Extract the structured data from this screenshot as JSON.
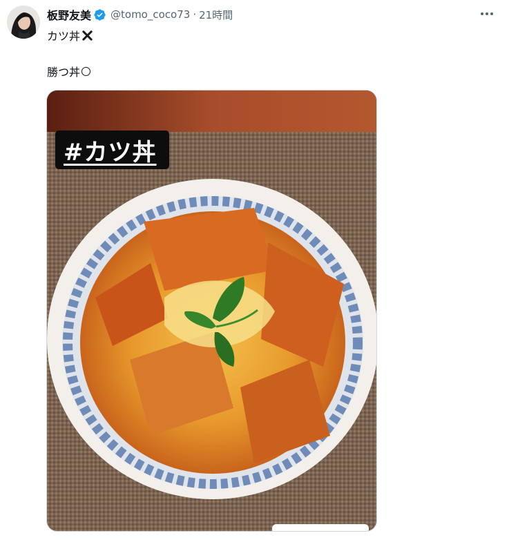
{
  "post": {
    "author_name": "板野友美",
    "verified_icon": "verified-badge-icon",
    "handle": "@tomo_coco73",
    "separator": "·",
    "timestamp": "21時間",
    "more_icon": "more-dots-icon",
    "text_line1": "カツ丼",
    "text_line1_icon": "cross-mark-icon",
    "text_line2": "勝つ丼",
    "text_line2_icon": "circle-mark-icon"
  },
  "media": {
    "overlay_tag": "#カツ丼"
  },
  "colors": {
    "verified_blue": "#1d9bf0",
    "text_primary": "#0f1419",
    "text_secondary": "#536471"
  }
}
